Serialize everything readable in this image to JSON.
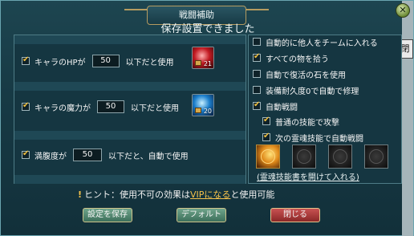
{
  "window": {
    "title": "戦闘補助",
    "saved_message": "保存設置できました",
    "side_tab_text": "閉"
  },
  "left": {
    "hp": {
      "label": "キャラのHPが",
      "value": "50",
      "suffix": "以下だと使用",
      "item_count": "21",
      "checked": true
    },
    "mp": {
      "label": "キャラの魔力が",
      "value": "50",
      "suffix": "以下だと使用",
      "item_count": "20",
      "checked": true
    },
    "hunger": {
      "label": "満腹度が",
      "value": "50",
      "suffix": "以下だと、自動で使用",
      "checked": true
    }
  },
  "right": {
    "options": [
      {
        "label": "自動的に他人をチームに入れる",
        "checked": false
      },
      {
        "label": "すべての物を拾う",
        "checked": true
      },
      {
        "label": "自動で復活の石を使用",
        "checked": false
      },
      {
        "label": "装備耐久度0で自動で修理",
        "checked": false
      },
      {
        "label": "自動戦闘",
        "checked": true
      },
      {
        "label": "普通の技能で攻撃",
        "checked": true
      },
      {
        "label": "次の霊魂技能で自動戦闘",
        "checked": true
      }
    ],
    "skill_link": "(霊魂技能書を開けて入れる)"
  },
  "hint": {
    "prefix": "ヒント：使用不可の効果は",
    "link": "VIPになる",
    "suffix": "と使用可能"
  },
  "buttons": {
    "save": "設定を保存",
    "default": "デフォルト",
    "close": "閉じる"
  },
  "icons": {
    "close": "close-icon",
    "skill": "flame-skill-icon",
    "empty_slot": "empty-slot-icon",
    "lock": "lock-icon"
  }
}
